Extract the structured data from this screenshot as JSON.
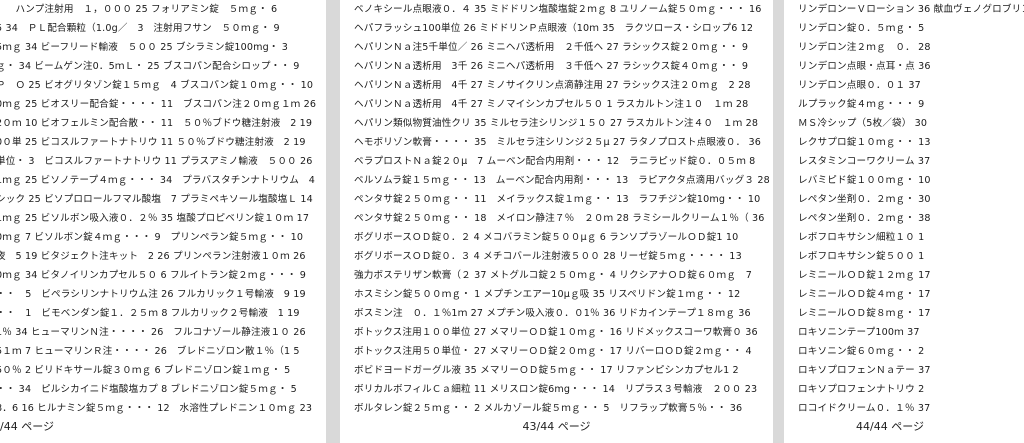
{
  "pages": [
    {
      "footer": "/44 ページ",
      "lines": [
        "　　ハンプ注射用　１，０００ 25 フォリアミン錠　５ｍｇ・ 6",
        "5 34　ＰＬ配合顆粒（1.0g／　3　注射用フサン　５０ｍｇ・ 9",
        "5ｍｇ 34 ビーフリード輸液　５００ 25 ブシラミン錠100mg・ 3",
        "ｇ・ 34 ビームゲン注0．5ｍＬ・ 25 ブスコパン配合シロップ・・ 9",
        "Ｐ　Ｏ 25 ビオグリタゾン錠１５ｍｇ　4 ブスコパン錠１０ｍｇ・・ 10",
        "0ｍｇ 25 ビオスリー配合錠・・・・ 11　ブスコパン注２０ｍｇ１ｍ 26",
        "2０ｍ 10 ビオフェルミン配合散・・ 11　５０％ブドウ糖注射液　2 19",
        "0０単 25 ビコスルファートナトリウ 11 ５０％ブドウ糖注射液　2 19",
        "単位・ 3　ビコスルファートナトリウ 11 プラスアミノ輸液　５００ 26",
        "1ｍｇ 25 ビソノテープ４ｍｇ・・・ 34　プラバスタチンナトリウム　4",
        "シック 25 ビソプロロールフマル酸塩　7 プラミペキソール塩酸塩Ｌ 14",
        "1ｍｇ 25 ビソルボン吸入液０．２％ 35 塩酸プロピベリン錠１０ｍ 17",
        "0ｍｇ 7 ビソルボン錠４ｍｇ・・・ 9　プリンペラン錠５ｍｇ・・ 10",
        "夜　5 19 ビタジェクト注キット　2 26 プリンペラン注射液１０ｍ 26",
        "0ｍｇ 34 ビタノイリンカプセル５０ 6 フルイトラン錠２ｍｇ・・・ 9",
        "・・　5　ビペラシリンナトリウム注 26 フルカリック１号輸液　9 19",
        "・・　1　ビモベンダン錠１．２５ｍ 8 フルカリック２号輸液　1 19",
        "1％ 34 ヒューマリンＮ注・・・・ 26　フルコナゾール静注液１０ 26",
        "5１ｍ 7 ヒューマリンＲ注・・・・ 26　ブレドニゾロン散１％（1 5",
        "5０％ 2 ビリドキサール錠３０ｍｇ 6 ブレドニゾロン錠１ｍｇ・ 5",
        "・・ 34　ピルシカイニド塩酸塩カプ 8 ブレドニゾロン錠５ｍｇ・ 5",
        "8．6 16 ヒルナミン錠５ｍｇ・・・ 12　水溶性プレドニン１０ｍｇ 23"
      ]
    },
    {
      "footer": "43/44 ページ",
      "lines": [
        "ベノキシール点眼液０．４ 35 ミドドリン塩酸塩錠２ｍｇ 8 ユリノーム錠５０ｍｇ・・・ 16",
        "ヘパフラッシュ100単位 26 ミドドリンＰ点眼液（10ｍ 35　ラクツロース・シロップ6 12",
        "ヘパリンＮａ注5千単位／ 26 ミニヘパ透析用　２千低ヘ 27 ラシックス錠２０ｍｇ・・ 9",
        "ヘパリンＮａ透析用　3千 26 ミニヘパ透析用　３千低ヘ 27 ラシックス錠４０ｍｇ・・ 9",
        "ヘパリンＮａ透析用　4千 27 ミノサイクリン点滴静注用 27 ラシックス注２０ｍｇ　2 28",
        "ヘパリンＮａ透析用　4千 27 ミノマイシンカプセル５０ 1 ラスカルトン注１０　１ｍ 28",
        "ヘパリン類似物質油性クリ 35 ミルセラ注シリンジ１５０ 27 ラスカルトン注４０　１ｍ 28",
        "ヘモボリゾン軟膏・・・・ 35　ミルセラ注シリンジ２５μ 27 ラタノプロスト点眼液０． 36",
        "ベラプロストＮａ錠２０μ　7 ムーベン配合内用剤・・・ 12　ラニラピッド錠０．０５ｍ 8",
        "ベルソムラ錠１５ｍｇ・・ 13　ムーベン配合内用剤・・・ 13　ラピアクタ点滴用バッグ３ 28",
        "ペンタサ錠２５０ｍｇ・・ 11　メイラックス錠１ｍｇ・・ 13　ラフチジン錠10mg・・ 10",
        "ペンタサ錠２５０ｍｇ・・ 18　メイロン静注７％　２０ｍ 28 ラミシールクリーム１％（ 36",
        "ボグリボースＯＤ錠０．２ 4 メコバラミン錠５００μｇ 6 ランソプラゾールＯＤ錠1 10",
        "ボグリボースＯＤ錠０．３ 4 メチコバール注射液５００ 28 リーゼ錠５ｍｇ・・・・ 13",
        "強力ボステリザン軟膏（２ 37 メトグルコ錠２５０ｍｇ・ 4 リクシアナＯＤ錠６０ｍｇ　7",
        "ホスミシン錠５００ｍｇ・ 1 メプチンエアー10μｇ吸 35 リスペリドン錠１ｍｇ・・ 12",
        "ボスミン注　０．１％1ｍ 27 メプチン吸入液０．０1％ 36 リドカインテープ１８ｍｇ 36",
        "ボトックス注用１００単位 27 メマリーＯＤ錠１０ｍｇ・ 16 リドメックスコーワ軟膏０ 36",
        "ボトックス注用５０単位・ 27 メマリーＯＤ錠２０ｍｇ・ 17 リバーロＯＤ錠２ｍｇ・・ 4",
        "ボビドヨードガーグル液 35 メマリーＯＤ錠５ｍｇ・・ 17 リファンピシンカプセル1 2",
        "ボリカルボフィルＣａ細粒 11 メリスロン錠6mg・・・ 14　リプラス３号輸液　２００ 23",
        "ボルタレン錠２５ｍｇ・・ 2 メルカゾール錠５ｍｇ・・ 5　リフラップ軟膏５％・・ 36"
      ]
    },
    {
      "footer": "44/44 ページ",
      "lines": [
        "リンデロンーＶローション 36 献血ヴェノグロブリン",
        "リンデロン錠０．５ｍｇ・ 5",
        "リンデロン注２ｍｇ　０． 28",
        "リンデロン点眼・点耳・点 36",
        "リンデロン点眼０．０１ 37",
        "ルプラック錠４ｍｇ・・・ 9",
        "ＭＳ冷シップ（5枚／袋） 30",
        "レクサプロ錠１０ｍｇ・・ 13",
        "レスタミンコーワクリーム 37",
        "レバミピド錠１００ｍｇ・ 10",
        "レペタン坐剤０．２ｍｇ・ 30",
        "レペタン坐剤０．２ｍｇ・ 38",
        "レボフロキサシン細粒１０ 1",
        "レボフロキサシン錠５００ 1",
        "レミニールＯＤ錠１２ｍｇ 17",
        "レミニールＯＤ錠４ｍｇ・ 17",
        "レミニールＯＤ錠８ｍｇ・ 17",
        "ロキソニンテープ100ｍ 37",
        "ロキソニン錠６０ｍｇ・・ 2",
        "ロキソプロフェンＮａテー 37",
        "ロキソプロフェンナトリウ 2",
        "ロコイドクリーム０．１％ 37"
      ]
    }
  ]
}
